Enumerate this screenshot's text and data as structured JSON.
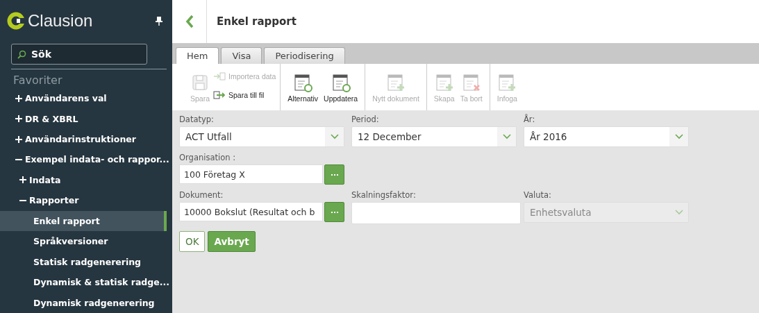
{
  "sidebar": {
    "logo": "Clausion",
    "search": {
      "placeholder": "Sök"
    },
    "section": "Favoriter",
    "tree": [
      {
        "label": "Användarens val",
        "expanded": false,
        "selected": false
      },
      {
        "label": "DR & XBRL",
        "expanded": false,
        "selected": false
      },
      {
        "label": "Användarinstruktioner",
        "expanded": false,
        "selected": false
      },
      {
        "label": "Exempel indata- och rappor...",
        "expanded": true,
        "selected": false,
        "children": [
          {
            "label": "Indata",
            "expanded": false,
            "selected": false
          },
          {
            "label": "Rapporter",
            "expanded": true,
            "selected": false,
            "children": [
              {
                "label": "Enkel rapport",
                "selected": true
              },
              {
                "label": "Språkversioner",
                "selected": false
              },
              {
                "label": "Statisk radgenerering",
                "selected": false
              },
              {
                "label": "Dynamisk & statisk radge...",
                "selected": false
              },
              {
                "label": "Dynamisk radgenerering",
                "selected": false
              }
            ]
          }
        ]
      }
    ]
  },
  "header": {
    "title": "Enkel rapport"
  },
  "tabs": [
    {
      "label": "Hem",
      "selected": true
    },
    {
      "label": "Visa",
      "selected": false
    },
    {
      "label": "Periodisering",
      "selected": false
    }
  ],
  "ribbon": [
    {
      "buttons": [
        {
          "label": "Spara",
          "kind": "large",
          "disabled": true
        },
        {
          "label": "Importera data",
          "kind": "small",
          "disabled": true
        },
        {
          "label": "Spara till fil",
          "kind": "small",
          "disabled": false
        }
      ]
    },
    {
      "buttons": [
        {
          "label": "Alternativ",
          "kind": "large",
          "disabled": false
        },
        {
          "label": "Uppdatera",
          "kind": "large",
          "disabled": false
        }
      ]
    },
    {
      "buttons": [
        {
          "label": "Nytt dokument",
          "kind": "large",
          "disabled": true
        }
      ]
    },
    {
      "buttons": [
        {
          "label": "Skapa",
          "kind": "large",
          "disabled": true
        },
        {
          "label": "Ta bort",
          "kind": "large",
          "disabled": true
        }
      ]
    },
    {
      "buttons": [
        {
          "label": "Infoga",
          "kind": "large",
          "disabled": true
        }
      ]
    }
  ],
  "form": {
    "rows": [
      [
        {
          "label": "Datatyp:",
          "kind": "select",
          "value": "ACT Utfall",
          "disabled": false
        },
        {
          "label": "Period:",
          "kind": "select",
          "value": "12 December",
          "disabled": false
        },
        {
          "label": "År:",
          "kind": "select",
          "value": "År 2016",
          "disabled": false
        }
      ],
      [
        {
          "label": "Organisation :",
          "kind": "lookup",
          "value": "100 Företag X",
          "disabled": false
        }
      ],
      [
        {
          "label": "Dokument:",
          "kind": "lookup",
          "value": "10000 Bokslut (Resultat och b",
          "disabled": false
        },
        {
          "label": "Skalningsfaktor:",
          "kind": "text",
          "disabled": false
        },
        {
          "label": "Valuta:",
          "kind": "select",
          "value": "Enhetsvaluta",
          "disabled": true
        }
      ]
    ],
    "buttons": [
      {
        "label": "OK",
        "kind": "secondary"
      },
      {
        "label": "Avbryt",
        "kind": "primary"
      }
    ]
  }
}
